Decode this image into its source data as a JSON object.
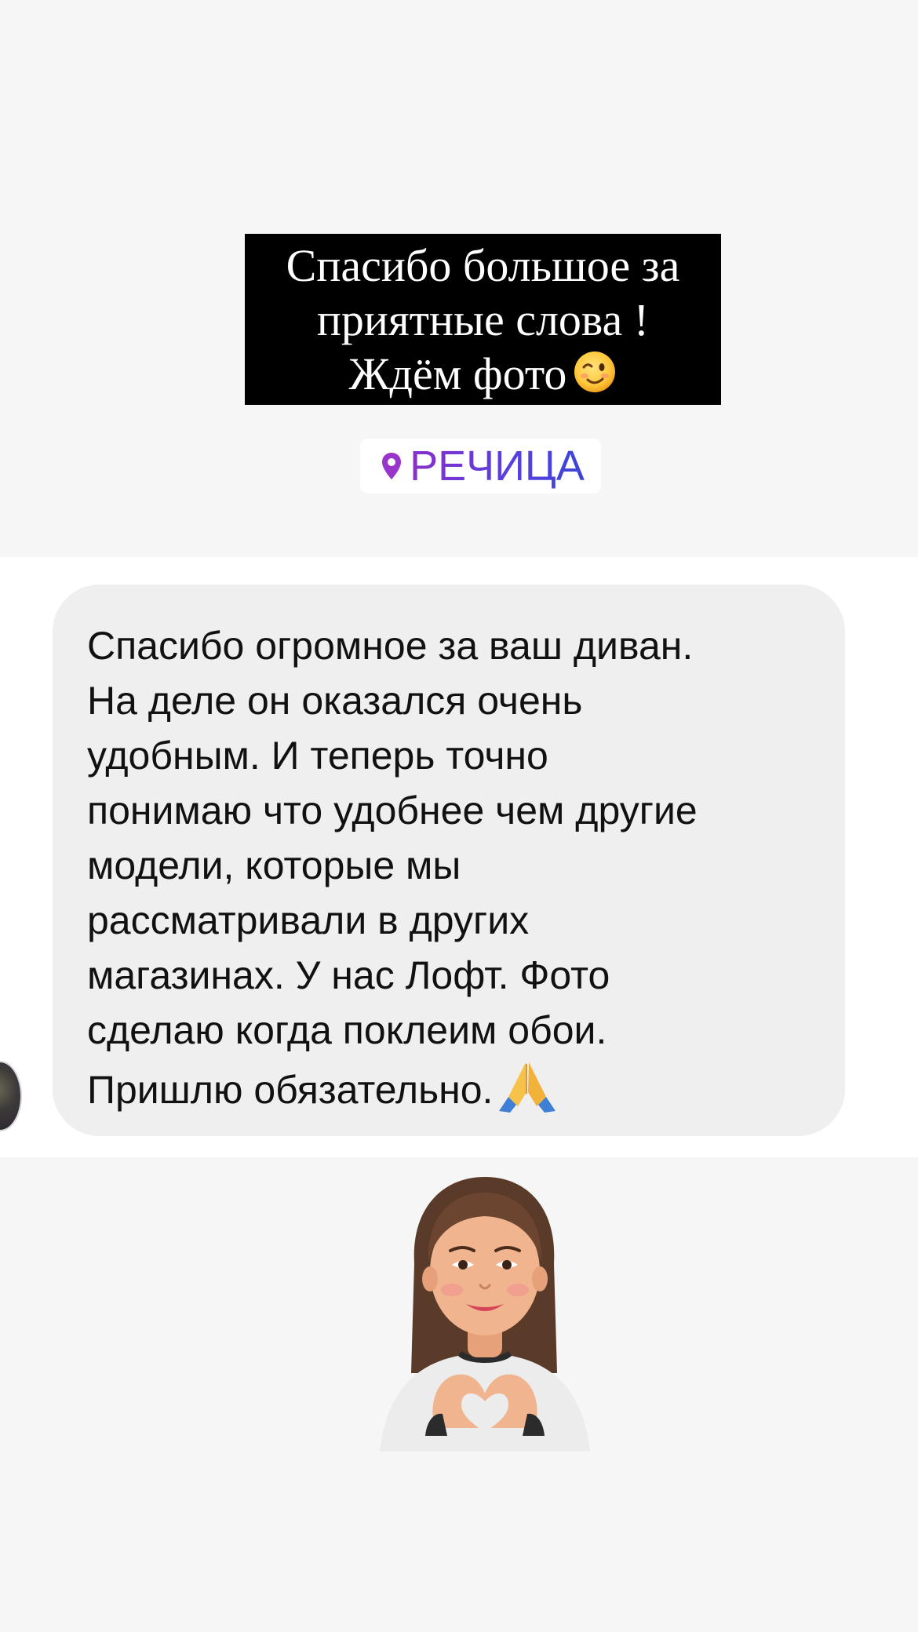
{
  "story": {
    "caption_lines": [
      "Спасибо большое за",
      "приятные слова !",
      "Ждём  фото"
    ],
    "caption_emoji": "winking-face",
    "location_label": "РЕЧИЦА"
  },
  "message": {
    "lines": [
      "Спасибо огромное за ваш диван.",
      "На деле он оказался очень",
      "удобным. И теперь точно",
      "понимаю что удобнее чем другие",
      "модели, которые мы",
      "рассматривали в других",
      "магазинах. У нас Лофт. Фото",
      "сделаю когда поклеим обои.",
      "Пришлю обязательно."
    ],
    "trailing_emoji": "folded-hands"
  },
  "sticker": {
    "name": "memoji-heart-hands"
  },
  "colors": {
    "caption_bg": "#000000",
    "caption_text": "#ffffff",
    "bubble_bg": "#efefef",
    "location_gradient_start": "#8a2fc9",
    "location_gradient_end": "#3b44d8"
  }
}
